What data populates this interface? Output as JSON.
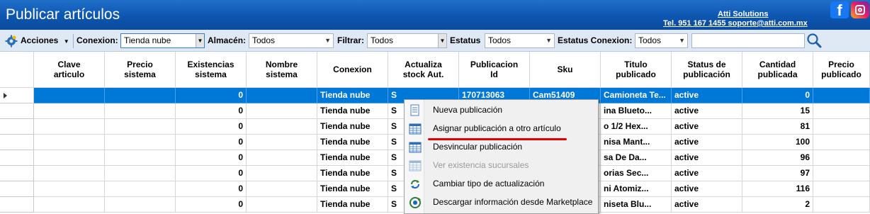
{
  "window": {
    "title": "Publicar artículos",
    "company": "Atti Solutions",
    "contact": "Tel. 951 167 1455  soporte@atti.com.mx",
    "facebook_glyph": "f"
  },
  "toolbar": {
    "acciones_label": "Acciones",
    "conexion_label": "Conexion:",
    "conexion_value": "Tienda nube",
    "almacen_label": "Almacén:",
    "almacen_value": "Todos",
    "filtrar_label": "Filtrar:",
    "filtrar_value": "Todos",
    "estatus_label": "Estatus",
    "estatus_value": "Todos",
    "estatus_conexion_label": "Estatus Conexion:",
    "estatus_conexion_value": "Todos",
    "search_value": ""
  },
  "grid": {
    "columns": [
      "Clave\narticulo",
      "Precio\nsistema",
      "Existencias\nsistema",
      "Nombre\nsistema",
      "Conexion",
      "Actualiza\nstock Aut.",
      "Publicacion\nId",
      "Sku",
      "Titulo\npublicado",
      "Status de\npublicación",
      "Cantidad\npublicada",
      "Precio\npublicado"
    ],
    "rows": [
      [
        "",
        "",
        "0",
        "",
        "Tienda nube",
        "S",
        "170713063",
        "Cam51409",
        "Camioneta Te...",
        "active",
        "0",
        ""
      ],
      [
        "",
        "",
        "0",
        "",
        "Tienda nube",
        "S",
        "",
        "",
        "ina Blueto...",
        "active",
        "15",
        ""
      ],
      [
        "",
        "",
        "0",
        "",
        "Tienda nube",
        "S",
        "",
        "",
        "o 1/2 Hex...",
        "active",
        "81",
        ""
      ],
      [
        "",
        "",
        "0",
        "",
        "Tienda nube",
        "S",
        "",
        "",
        "nisa Mant...",
        "active",
        "100",
        ""
      ],
      [
        "",
        "",
        "0",
        "",
        "Tienda nube",
        "S",
        "",
        "",
        "sa De Da...",
        "active",
        "96",
        ""
      ],
      [
        "",
        "",
        "0",
        "",
        "Tienda nube",
        "S",
        "",
        "",
        "orias Sec...",
        "active",
        "97",
        ""
      ],
      [
        "",
        "",
        "0",
        "",
        "Tienda nube",
        "S",
        "",
        "",
        "ni Atomiz...",
        "active",
        "116",
        ""
      ],
      [
        "",
        "",
        "0",
        "",
        "Tienda nube",
        "S",
        "",
        "",
        "niseta Blu...",
        "active",
        "2",
        ""
      ]
    ]
  },
  "context_menu": {
    "items": [
      {
        "label": "Nueva publicación",
        "icon": "document-icon",
        "disabled": false
      },
      {
        "label": "Asignar publicación a otro artículo",
        "icon": "table-icon",
        "disabled": false
      },
      {
        "label": "Desvincular publicación",
        "icon": "table-icon",
        "disabled": false
      },
      {
        "label": "Ver existencia sucursales",
        "icon": "table-icon",
        "disabled": true
      },
      {
        "label": "Cambiar tipo de actualización",
        "icon": "sync-icon",
        "disabled": false
      },
      {
        "label": "Descargar información desde Marketplace",
        "icon": "download-sync-icon",
        "disabled": false
      }
    ]
  },
  "colors": {
    "titlebar": "#0d56b0",
    "selection": "#0078d7",
    "toolbar": "#dfe9f5",
    "annotation": "#e00000"
  }
}
